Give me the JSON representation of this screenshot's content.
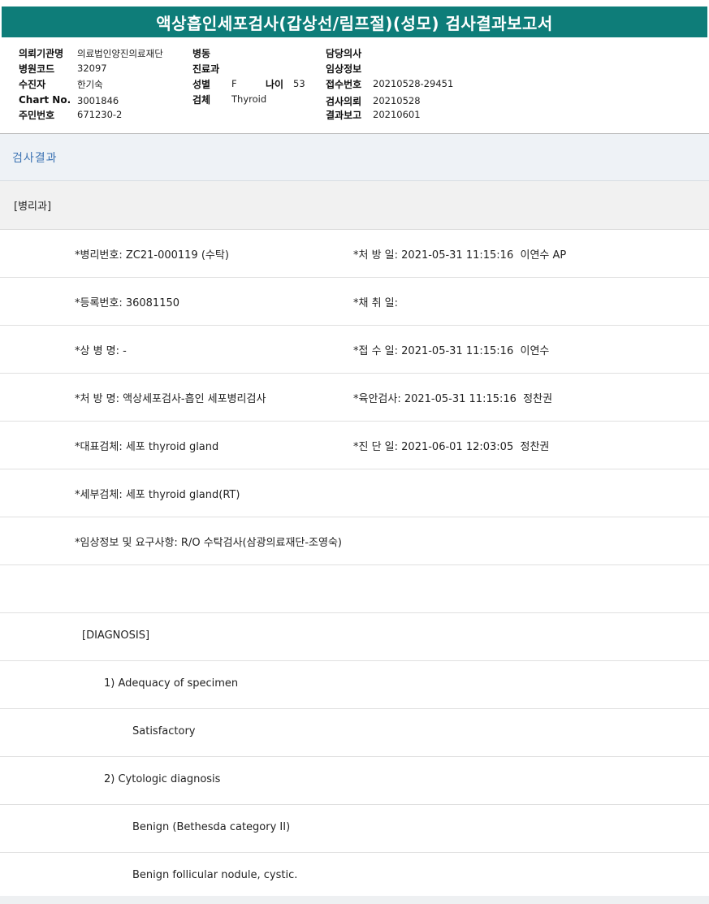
{
  "title": "액상흡인세포검사(갑상선/림프절)(성모) 검사결과보고서",
  "patient_info": {
    "institution_label": "의뢰기관명",
    "institution": "의료법인양진의료재단",
    "hospital_code_label": "병원코드",
    "hospital_code": "32097",
    "patient_label": "수진자",
    "patient": "한기숙",
    "chart_label": "Chart No.",
    "chart_no": "3001846",
    "resident_label": "주민번호",
    "resident_no": "671230-2",
    "ward_label": "병동",
    "ward": "",
    "department_label": "진료과",
    "department": "",
    "sex_label": "성별",
    "sex": "F",
    "age_label": "나이",
    "age": "53",
    "specimen_label": "검체",
    "specimen": "Thyroid",
    "doctor_label": "담당의사",
    "doctor": "",
    "clinical_label": "임상정보",
    "clinical": "",
    "receipt_label": "접수번호",
    "receipt_no": "20210528-29451",
    "request_label": "검사의뢰",
    "request_date": "20210528",
    "report_label": "결과보고",
    "report_date": "20210601"
  },
  "section_title": "검사결과",
  "dept_title": "[병리과]",
  "rows": [
    {
      "left": "*병리번호: ZC21-000119 (수탁)",
      "right": "*처 방 일: 2021-05-31 11:15:16  이연수 AP"
    },
    {
      "left": "*등록번호: 36081150",
      "right": "*채 취 일:"
    },
    {
      "left": "*상 병 명: -",
      "right": "*접 수 일: 2021-05-31 11:15:16  이연수"
    },
    {
      "left": "*처 방 명: 액상세포검사-흡인 세포병리검사",
      "right": "*육안검사: 2021-05-31 11:15:16  정찬권"
    },
    {
      "left": "*대표검체: 세포 thyroid gland",
      "right": "*진 단 일: 2021-06-01 12:03:05  정찬권"
    },
    {
      "left": "*세부검체: 세포 thyroid gland(RT)",
      "right": ""
    },
    {
      "left": "*임상정보 및 요구사항: R/O 수탁검사(삼광의료재단-조영숙)",
      "right": ""
    },
    {
      "left": "",
      "right": ""
    }
  ],
  "diagnosis": [
    {
      "text": "[DIAGNOSIS]",
      "indent": 1
    },
    {
      "text": "1) Adequacy of specimen",
      "indent": 2
    },
    {
      "text": "Satisfactory",
      "indent": 3
    },
    {
      "text": "2) Cytologic diagnosis",
      "indent": 2
    },
    {
      "text": "Benign (Bethesda category II)",
      "indent": 3
    },
    {
      "text": "Benign follicular nodule, cystic.",
      "indent": 3
    }
  ]
}
